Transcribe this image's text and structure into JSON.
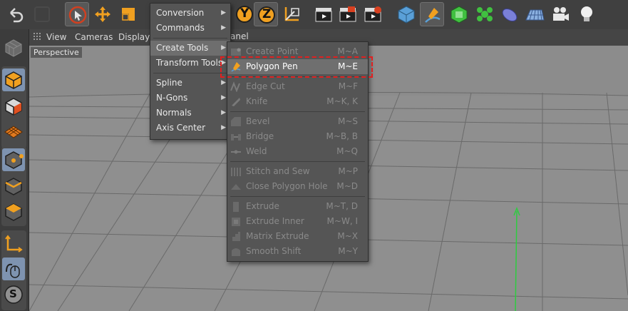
{
  "view_menu": {
    "items": [
      "View",
      "Cameras",
      "Display"
    ],
    "partial_label": "anel"
  },
  "viewport": {
    "label": "Perspective"
  },
  "main_menu": {
    "items": [
      {
        "label": "Conversion",
        "has_submenu": true
      },
      {
        "label": "Commands",
        "has_submenu": true
      },
      {
        "label": "Create Tools",
        "has_submenu": true,
        "active": true
      },
      {
        "label": "Transform Tools",
        "has_submenu": true
      },
      {
        "label": "Spline",
        "has_submenu": true
      },
      {
        "label": "N-Gons",
        "has_submenu": true
      },
      {
        "label": "Normals",
        "has_submenu": true
      },
      {
        "label": "Axis Center",
        "has_submenu": true
      }
    ]
  },
  "create_tools_submenu": {
    "items": [
      {
        "label": "Create Point",
        "shortcut": "M~A",
        "enabled": false
      },
      {
        "label": "Polygon Pen",
        "shortcut": "M~E",
        "enabled": true,
        "highlighted": true
      },
      {
        "label": "Edge Cut",
        "shortcut": "M~F",
        "enabled": false
      },
      {
        "label": "Knife",
        "shortcut": "M~K, K",
        "enabled": false
      },
      {
        "label": "Bevel",
        "shortcut": "M~S",
        "enabled": false
      },
      {
        "label": "Bridge",
        "shortcut": "M~B, B",
        "enabled": false
      },
      {
        "label": "Weld",
        "shortcut": "M~Q",
        "enabled": false
      },
      {
        "label": "Stitch and Sew",
        "shortcut": "M~P",
        "enabled": false
      },
      {
        "label": "Close Polygon Hole",
        "shortcut": "M~D",
        "enabled": false
      },
      {
        "label": "Extrude",
        "shortcut": "M~T, D",
        "enabled": false
      },
      {
        "label": "Extrude Inner",
        "shortcut": "M~W, I",
        "enabled": false
      },
      {
        "label": "Matrix Extrude",
        "shortcut": "M~X",
        "enabled": false
      },
      {
        "label": "Smooth Shift",
        "shortcut": "M~Y",
        "enabled": false
      }
    ]
  },
  "toolbar": {
    "axis_y_label": "Y",
    "axis_z_label": "Z"
  },
  "left_palette": {
    "snap_label": "S"
  },
  "colors": {
    "highlight_box": "#e02020",
    "accent_orange": "#f0a020",
    "selection_blue": "#7e93b0"
  }
}
